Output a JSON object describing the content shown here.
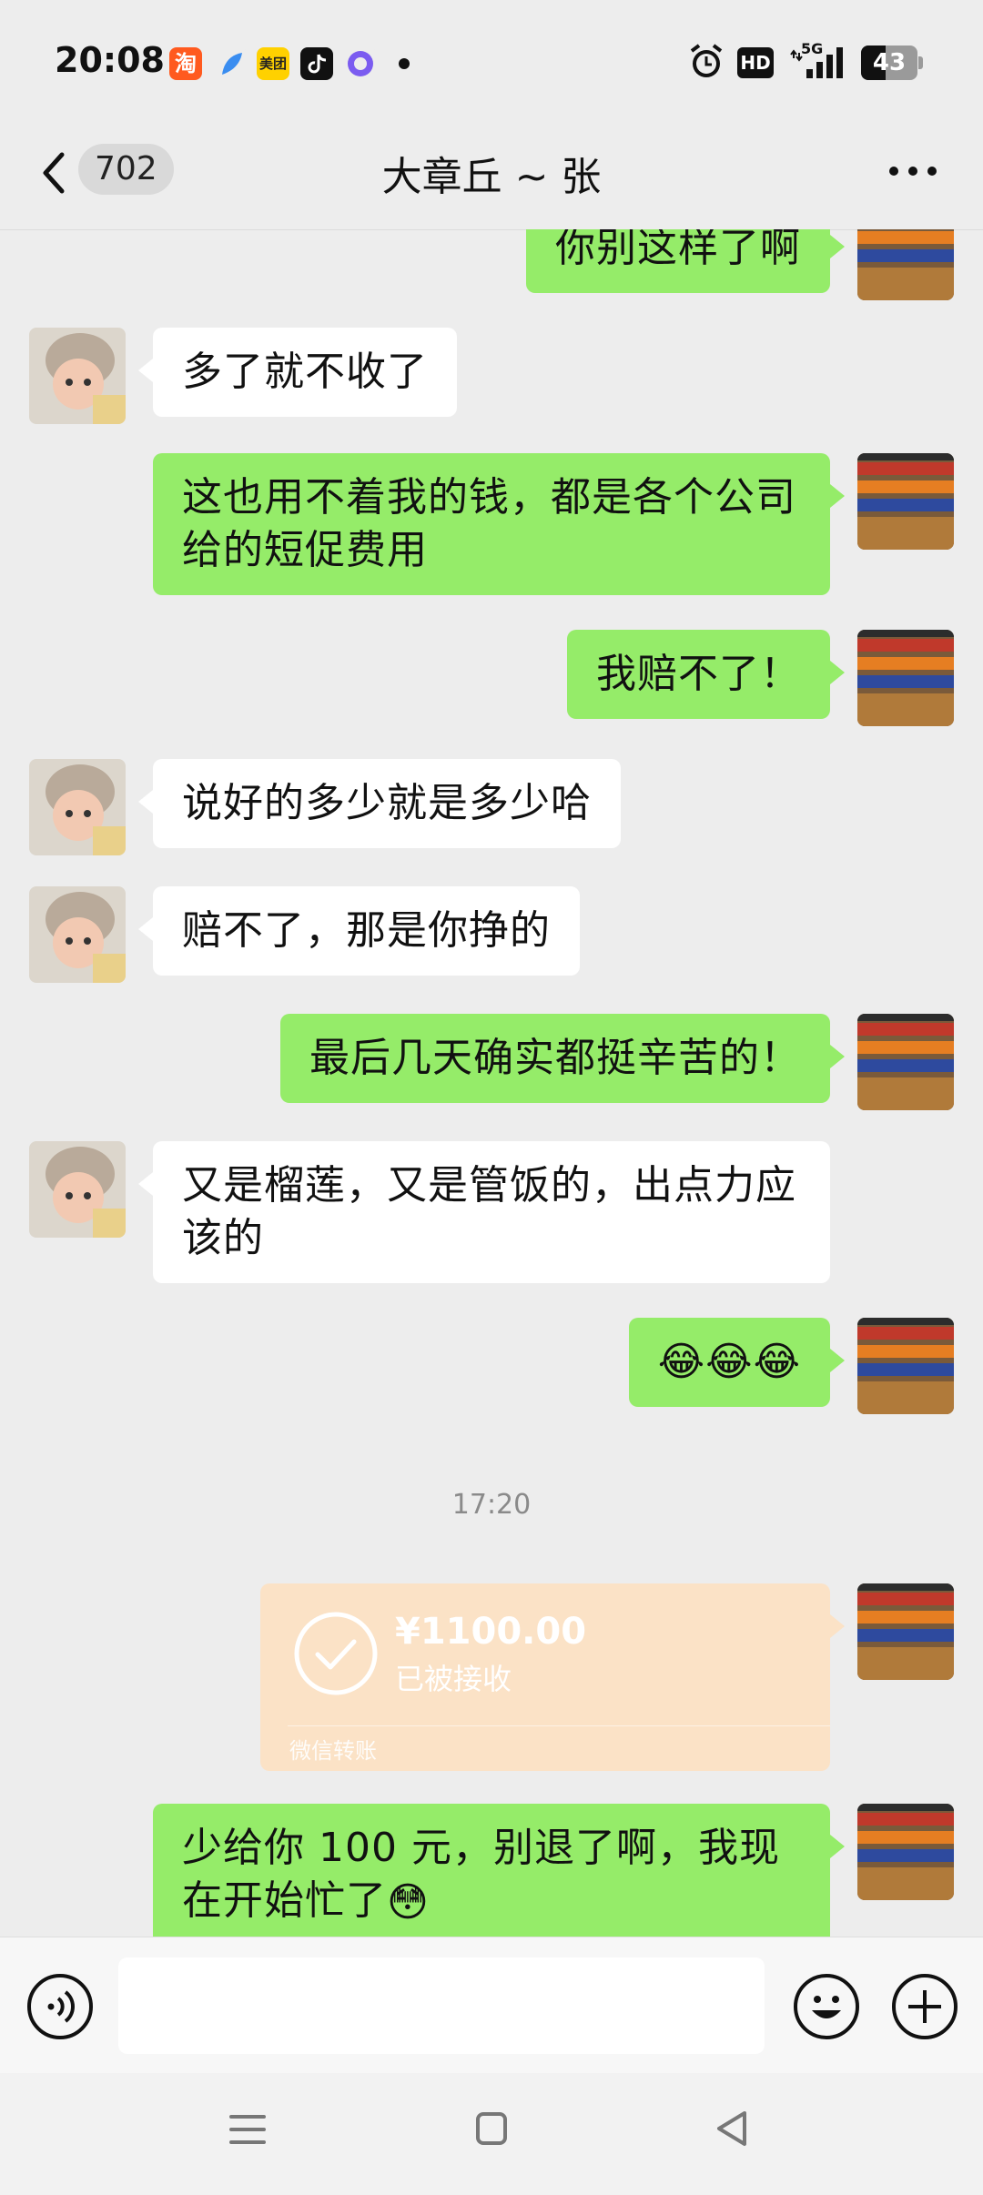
{
  "status_bar": {
    "time": "20:08",
    "network": "5G",
    "battery": "43",
    "notification_icons": [
      "taobao-icon",
      "feather-app-icon",
      "meituan-icon",
      "tiktok-icon",
      "purple-app-icon"
    ],
    "system_icons": [
      "alarm-icon",
      "hd-icon",
      "signal-icon",
      "battery-icon"
    ]
  },
  "header": {
    "unread_count": "702",
    "title": "大章丘 ~ 张"
  },
  "messages": [
    {
      "from": "me",
      "text": "你别这样了啊"
    },
    {
      "from": "other",
      "text": "多了就不收了"
    },
    {
      "from": "me",
      "text": "这也用不着我的钱，都是各个公司给的短促费用"
    },
    {
      "from": "me",
      "text": "我赔不了！"
    },
    {
      "from": "other",
      "text": "说好的多少就是多少哈"
    },
    {
      "from": "other",
      "text": "赔不了，那是你挣的"
    },
    {
      "from": "me",
      "text": "最后几天确实都挺辛苦的！"
    },
    {
      "from": "other",
      "text": "又是榴莲，又是管饭的，出点力应该的"
    },
    {
      "from": "me",
      "text": "😂😂😂"
    },
    {
      "type": "timestamp",
      "text": "17:20"
    },
    {
      "from": "me",
      "type": "transfer",
      "amount": "¥1100.00",
      "status": "已被接收",
      "footer": "微信转账"
    },
    {
      "from": "me",
      "text": "少给你 100 元，别退了啊，我现在开始忙了",
      "emoji": "😳"
    }
  ],
  "input_bar": {
    "value": "",
    "icons": [
      "voice-icon",
      "emoji-icon",
      "plus-icon"
    ]
  },
  "colors": {
    "outgoing_bubble": "#95ec69",
    "incoming_bubble": "#ffffff",
    "transfer_card": "#fbe2c6",
    "background": "#ededed"
  }
}
